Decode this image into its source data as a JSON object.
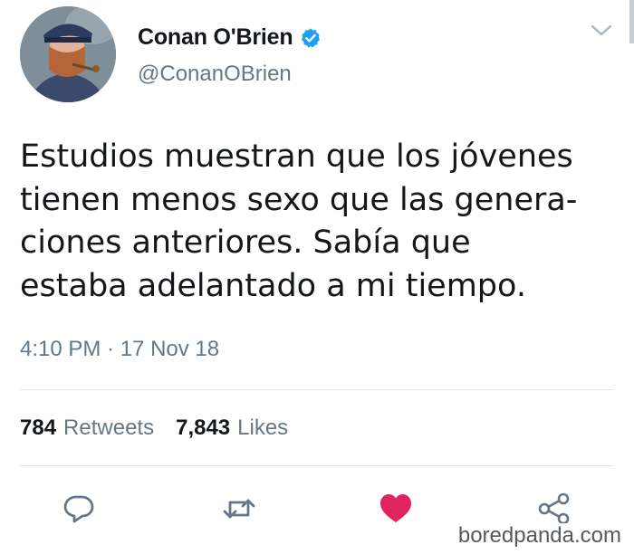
{
  "tweet": {
    "display_name": "Conan O'Brien",
    "handle": "@ConanOBrien",
    "verified": true,
    "text_lines": [
      "Estudios muestran que los jóvenes",
      "tienen menos sexo que las genera-",
      "ciones anteriores. Sabía que",
      "estaba adelantado a mi tiempo."
    ],
    "timestamp": "4:10 PM · 17 Nov 18"
  },
  "stats": {
    "retweets_count": "784",
    "retweets_label": "Retweets",
    "likes_count": "7,843",
    "likes_label": "Likes"
  },
  "actions": {
    "reply_icon": "reply-icon",
    "retweet_icon": "retweet-icon",
    "like_icon": "heart-icon",
    "share_icon": "share-icon",
    "liked": true
  },
  "watermark": "boredpanda.com",
  "colors": {
    "text_primary": "#14171a",
    "text_secondary": "#657786",
    "verified_blue": "#1da1f2",
    "like_red": "#e0245e",
    "divider": "#e1e8ed"
  }
}
